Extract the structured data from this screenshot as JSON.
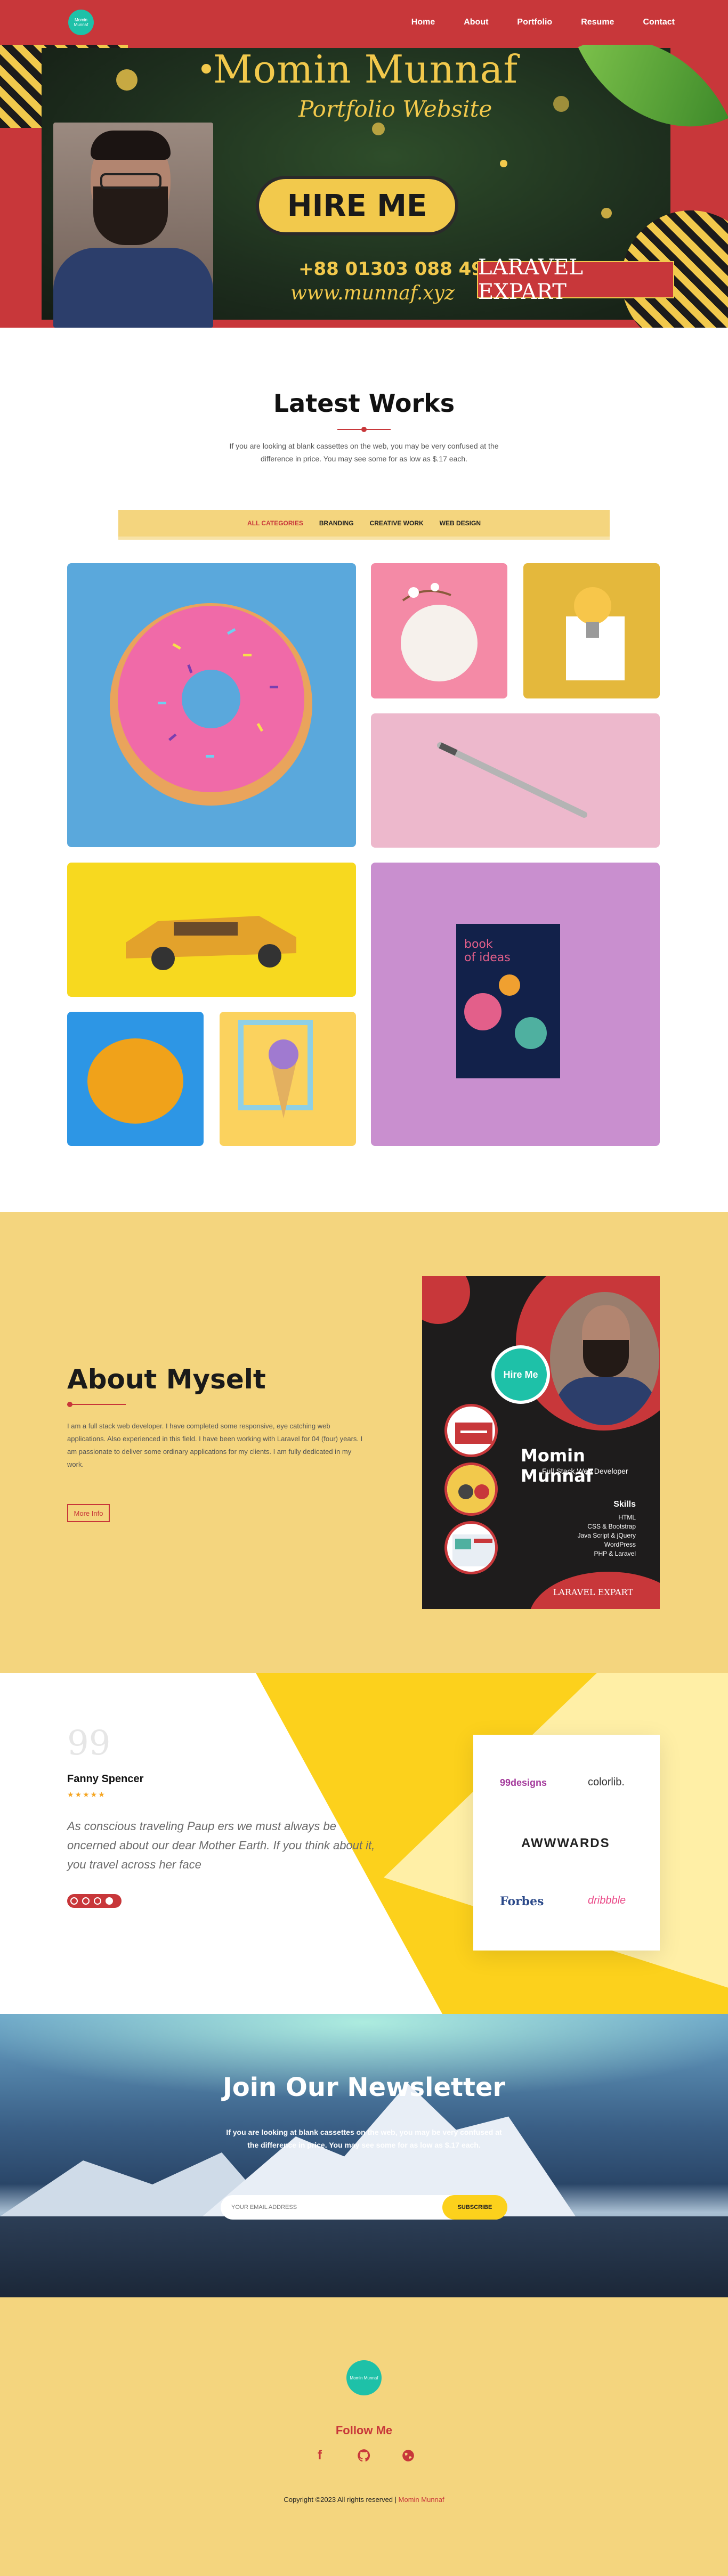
{
  "nav": {
    "logo_text": "Momin Munnaf",
    "links": [
      "Home",
      "About",
      "Portfolio",
      "Resume",
      "Contact"
    ]
  },
  "hero": {
    "title": "Momin Munnaf",
    "subtitle": "Portfolio Website",
    "cta": "HIRE ME",
    "phone": "+88 01303 088 494",
    "website": "www.munnaf.xyz",
    "badge": "LARAVEL EXPART"
  },
  "works": {
    "title": "Latest Works",
    "description": "If you are looking at blank cassettes on the web, you may be very confused at the difference in price. You may see some for as low as $.17 each.",
    "filters": [
      "ALL CATEGORIES",
      "BRANDING",
      "CREATIVE WORK",
      "WEB DESIGN"
    ],
    "active_filter": 0,
    "tiles": [
      {
        "name": "donut"
      },
      {
        "name": "plate"
      },
      {
        "name": "bulb"
      },
      {
        "name": "pen"
      },
      {
        "name": "toy-car"
      },
      {
        "name": "book"
      },
      {
        "name": "orange"
      },
      {
        "name": "ice-cream"
      }
    ]
  },
  "about": {
    "title": "About Myselt",
    "text": "I am a full stack web developer. I have completed some responsive, eye catching web applications. Also experienced in this field. I have been working with Laravel for 04 (four) years. I am passionate to deliver some ordinary applications for my clients. I am fully dedicated in my work.",
    "more_button": "More Info",
    "card": {
      "hire": "Hire Me",
      "name": "Momin Munnaf",
      "role": "Full Stack Web Developer",
      "skills_title": "Skills",
      "skills": [
        "HTML",
        "CSS & Bootstrap",
        "Java Script & jQuery",
        "WordPress",
        "PHP & Laravel"
      ],
      "badge": "LARAVEL EXPART"
    }
  },
  "testimonial": {
    "quote_mark": "99",
    "name": "Fanny Spencer",
    "stars": "★★★★★",
    "text": "As conscious traveling Paup ers we must always be oncerned about our dear Mother Earth. If you think about it, you travel across her face",
    "clients": [
      "99designs",
      "colorlib.",
      "AWWWARDS",
      "Forbes",
      "dribbble"
    ]
  },
  "newsletter": {
    "title": "Join Our Newsletter",
    "description": "If you are looking at blank cassettes on the web, you may be very confused at the difference in price. You may see some for as low as $.17 each.",
    "placeholder": "YOUR EMAIL ADDRESS",
    "button": "SUBSCRIBE"
  },
  "footer": {
    "logo_text": "Momin Munnaf",
    "follow": "Follow Me",
    "social": [
      "facebook-icon",
      "github-icon",
      "globe-icon"
    ],
    "copyright_prefix": "Copyright ©2023 All rights reserved |",
    "copyright_name": " Momin Munnaf"
  },
  "colors": {
    "primary_red": "#c8373a",
    "yellow": "#f4d57e",
    "accent_yellow": "#fcd11c",
    "teal": "#1ec1a8"
  }
}
